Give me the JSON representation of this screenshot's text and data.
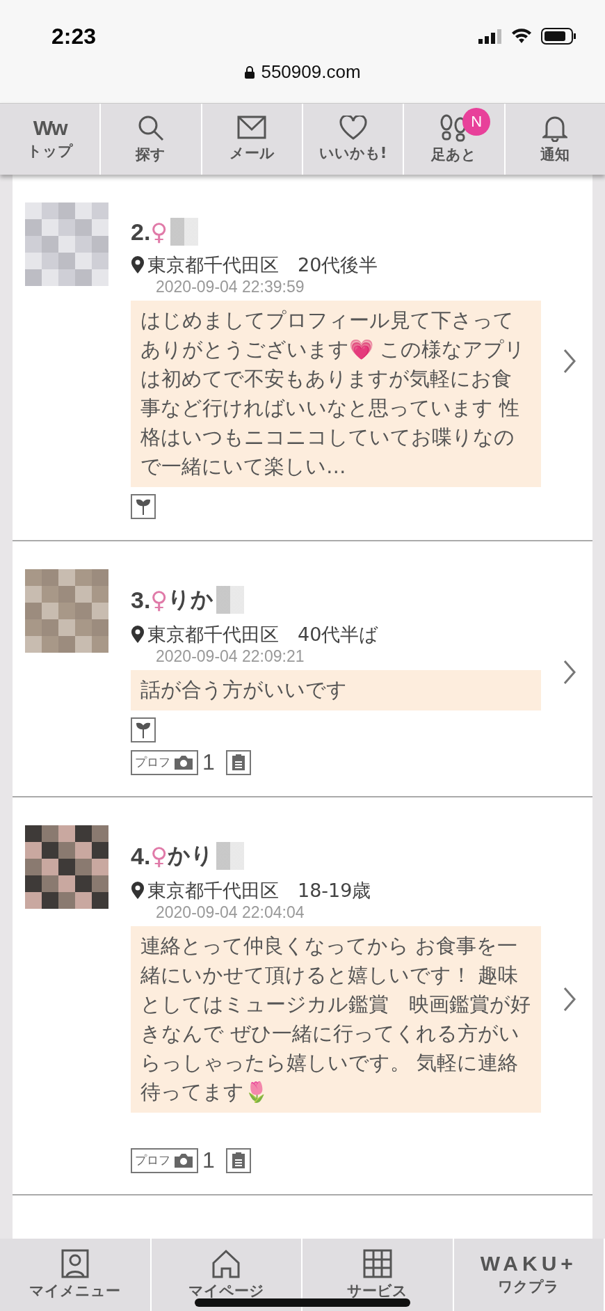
{
  "status_bar": {
    "time": "2:23"
  },
  "url_bar": {
    "url": "550909.com"
  },
  "top_nav": [
    {
      "kind": "logo",
      "logo": "Ww",
      "label": "トップ",
      "selected": false
    },
    {
      "kind": "search",
      "label": "探す",
      "selected": false
    },
    {
      "kind": "mail",
      "label": "メール",
      "selected": false
    },
    {
      "kind": "heart",
      "label": "いいかも!",
      "selected": false
    },
    {
      "kind": "footprints",
      "label": "足あと",
      "badge": "N",
      "selected": false
    },
    {
      "kind": "bell",
      "label": "通知",
      "selected": false
    }
  ],
  "profiles": [
    {
      "rank": "2.",
      "sex": "♀",
      "location": "東京都千代田区",
      "age": "20代後半",
      "date": "2020-09-04 22:39:59",
      "message": "はじめましてプロフィール見て下さってありがとうございます💗 この様なアプリは初めてで不安もありますが気軽にお食事など行ければいいなと思っています 性格はいつもニコニコしていてお喋りなので一緒にいて楽しい…",
      "badge_rows": [
        [
          {
            "kind": "sprout"
          }
        ]
      ]
    },
    {
      "rank": "3.",
      "sex": "♀",
      "name": "りか",
      "location": "東京都千代田区",
      "age": "40代半ば",
      "date": "2020-09-04 22:09:21",
      "message": "話が合う方がいいです",
      "badge_rows": [
        [
          {
            "kind": "sprout"
          }
        ],
        [
          {
            "label": "プロフ",
            "count": "1"
          },
          {
            "kind": "memo"
          }
        ]
      ]
    },
    {
      "rank": "4.",
      "sex": "♀",
      "name": "かり",
      "location": "東京都千代田区",
      "age": "18-19歳",
      "date": "2020-09-04 22:04:04",
      "message": "連絡とって仲良くなってから お食事を一緒にいかせて頂けると嬉しいです！ 趣味としてはミュージカル鑑賞　映画鑑賞が好きなんで ぜひ一緒に行ってくれる方がいらっしゃったら嬉しいです。 気軽に連絡待ってます🌷",
      "badge_rows": [
        [
          {
            "label": "プロフ",
            "count": "1"
          },
          {
            "kind": "memo"
          }
        ]
      ]
    }
  ],
  "bottom_nav": [
    {
      "kind": "person",
      "label": "マイメニュー"
    },
    {
      "kind": "home",
      "label": "マイページ"
    },
    {
      "kind": "grid",
      "label": "サービス"
    },
    {
      "kind": "logo",
      "logo": "WAKU+",
      "label": "ワクプラ"
    }
  ]
}
